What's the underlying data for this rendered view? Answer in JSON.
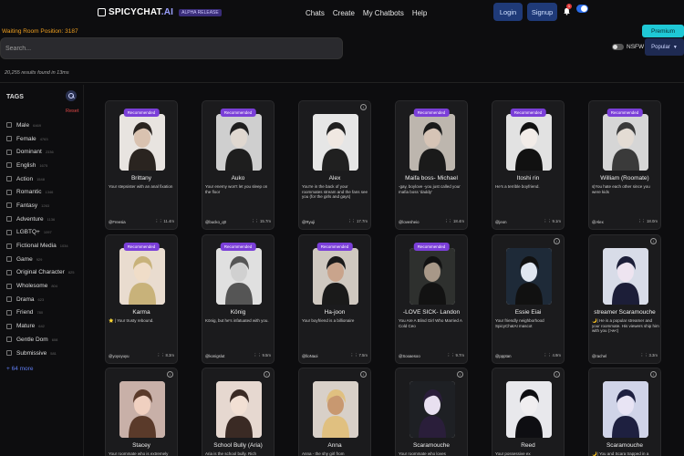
{
  "header": {
    "logo_text": "SPICYCHAT",
    "logo_ai": ".AI",
    "alpha_label": "ALPHA RELEASE",
    "nav": [
      "Chats",
      "Create",
      "My Chatbots",
      "Help"
    ],
    "login_label": "Login",
    "signup_label": "Signup",
    "bell_count": "1"
  },
  "waiting_text": "Waiting Room Position: 3187",
  "premium_label": "Premium",
  "search": {
    "placeholder": "Search..."
  },
  "nsfw_label": "NSFW",
  "sort_label": "Popular",
  "results_text": "20,255 results found in 13ms",
  "sidebar": {
    "title": "TAGS",
    "reset": "Reset",
    "tags": [
      {
        "label": "Male",
        "count": "6469"
      },
      {
        "label": "Female",
        "count": "4763"
      },
      {
        "label": "Dominant",
        "count": "2336"
      },
      {
        "label": "English",
        "count": "1675"
      },
      {
        "label": "Action",
        "count": "1548"
      },
      {
        "label": "Romantic",
        "count": "1346"
      },
      {
        "label": "Fantasy",
        "count": "1263"
      },
      {
        "label": "Adventure",
        "count": "1136"
      },
      {
        "label": "LGBTQ+",
        "count": "1097"
      },
      {
        "label": "Fictional Media",
        "count": "1034"
      },
      {
        "label": "Game",
        "count": "929"
      },
      {
        "label": "Original Character",
        "count": "825"
      },
      {
        "label": "Wholesome",
        "count": "804"
      },
      {
        "label": "Drama",
        "count": "623"
      },
      {
        "label": "Friend",
        "count": "780"
      },
      {
        "label": "Mature",
        "count": "642"
      },
      {
        "label": "Gentle Dom",
        "count": "608"
      },
      {
        "label": "Submissive",
        "count": "581"
      }
    ],
    "more": "+ 64 more"
  },
  "cards": [
    {
      "name": "Brittany",
      "desc": "Your stepsister with an anal fixation",
      "author": "@Freesia",
      "stats": "11.4m",
      "badge": "Recommended"
    },
    {
      "name": "Auko",
      "desc": "Your enemy won't let you sleep on the floor",
      "author": "@bucko_q0",
      "stats": "15.7m",
      "badge": "Recommended"
    },
    {
      "name": "Alex",
      "desc": "You're in the back of your roommates stream and the fans see you (for the girls and gays)",
      "author": "@Ryuji",
      "stats": "17.7m",
      "badge": ""
    },
    {
      "name": "Maifa boss- Michael",
      "desc": "-gay, boylove -you just called your mafia boss 'daddy'",
      "author": "@lovesheio",
      "stats": "18.4m",
      "badge": "Recommended"
    },
    {
      "name": "Itoshi rin",
      "desc": "He's a terrible boyfriend.",
      "author": "@jeon",
      "stats": "9.1m",
      "badge": "Recommended"
    },
    {
      "name": "William (Roomate)",
      "desc": "s|You hate each other since you were kids",
      "author": "@Alex",
      "stats": "18.0m",
      "badge": "Recommended"
    },
    {
      "name": "Karma",
      "desc": "⭐ | Your trusty rebound.",
      "author": "@yoyoyuyu",
      "stats": "8.3m",
      "badge": "Recommended"
    },
    {
      "name": "König",
      "desc": "König, but he's infatuated with you.",
      "author": "@konigslut",
      "stats": "9.5m",
      "badge": "Recommended"
    },
    {
      "name": "Ha-joon",
      "desc": "Your boyfriend is a billionaire",
      "author": "@lloNaoi",
      "stats": "7.5m",
      "badge": "Recommended"
    },
    {
      "name": "-LOVE SICK- Landon",
      "desc": "You Are A Blind Girl Who Married A Cold Ceo",
      "author": "@Sooaesoo",
      "stats": "9.7m",
      "badge": "Recommended"
    },
    {
      "name": "Essie Eiai",
      "desc": "Your friendly neighborhood SpicyChatAI mascot",
      "author": "@ppptan",
      "stats": "4.9m",
      "badge": ""
    },
    {
      "name": "streamer Scaramouche",
      "desc": "🌙| He is a popular streamer and your roommate. His viewers ship him with you (>w<)",
      "author": "@rachel",
      "stats": "3.3m",
      "badge": ""
    },
    {
      "name": "Stacey",
      "desc": "Your roommate who is extremely",
      "author": "",
      "stats": "",
      "badge": ""
    },
    {
      "name": "School Bully (Aria)",
      "desc": "Aria is the school bully. Rich",
      "author": "",
      "stats": "",
      "badge": ""
    },
    {
      "name": "Anna",
      "desc": "Anna - the shy girl from",
      "author": "",
      "stats": "",
      "badge": ""
    },
    {
      "name": "Scaramouche",
      "desc": "Your roommate who loves",
      "author": "",
      "stats": "",
      "badge": ""
    },
    {
      "name": "Reed",
      "desc": "Your possessive ex",
      "author": "",
      "stats": "",
      "badge": ""
    },
    {
      "name": "Scaramouche",
      "desc": "🌙| You and Scara trapped in a",
      "author": "",
      "stats": "",
      "badge": ""
    }
  ]
}
